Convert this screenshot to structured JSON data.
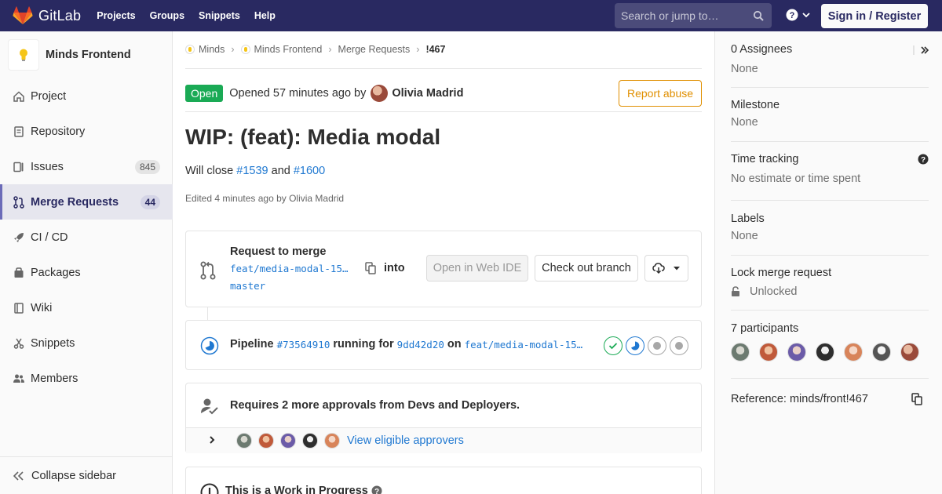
{
  "navbar": {
    "brand": "GitLab",
    "links": [
      "Projects",
      "Groups",
      "Snippets",
      "Help"
    ],
    "search_placeholder": "Search or jump to…",
    "signin": "Sign in / Register"
  },
  "sidebar": {
    "project_name": "Minds Frontend",
    "items": [
      {
        "label": "Project",
        "icon": "home-icon"
      },
      {
        "label": "Repository",
        "icon": "doc-icon"
      },
      {
        "label": "Issues",
        "icon": "issues-icon",
        "badge": "845"
      },
      {
        "label": "Merge Requests",
        "icon": "merge-request-icon",
        "badge": "44",
        "active": true
      },
      {
        "label": "CI / CD",
        "icon": "rocket-icon"
      },
      {
        "label": "Packages",
        "icon": "package-icon"
      },
      {
        "label": "Wiki",
        "icon": "book-icon"
      },
      {
        "label": "Snippets",
        "icon": "scissors-icon"
      },
      {
        "label": "Members",
        "icon": "users-icon"
      }
    ],
    "collapse": "Collapse sidebar"
  },
  "breadcrumb": {
    "items": [
      "Minds",
      "Minds Frontend",
      "Merge Requests"
    ],
    "current": "!467"
  },
  "mr": {
    "status": "Open",
    "opened_text": "Opened 57 minutes ago by",
    "author": "Olivia Madrid",
    "report": "Report abuse",
    "title": "WIP: (feat): Media modal",
    "desc_prefix": "Will close",
    "issue1": "#1539",
    "desc_and": "and",
    "issue2": "#1600",
    "edited": "Edited 4 minutes ago by Olivia Madrid"
  },
  "merge": {
    "title": "Request to merge",
    "source": "feat/media-modal-15…",
    "into": "into",
    "target": "master",
    "web_ide": "Open in Web IDE",
    "checkout": "Check out branch"
  },
  "pipeline": {
    "label": "Pipeline",
    "id": "#73564910",
    "running_for": "running for",
    "commit": "9dd42d20",
    "on": "on",
    "branch": "feat/media-modal-15…",
    "stages": [
      "passed",
      "running",
      "created",
      "created"
    ]
  },
  "approvals": {
    "text": "Requires 2 more approvals from Devs and Deployers.",
    "link": "View eligible approvers"
  },
  "wip": {
    "text": "This is a Work in Progress"
  },
  "right": {
    "assignees_label": "0 Assignees",
    "assignees_value": "None",
    "milestone_label": "Milestone",
    "milestone_value": "None",
    "time_label": "Time tracking",
    "time_value": "No estimate or time spent",
    "labels_label": "Labels",
    "labels_value": "None",
    "lock_label": "Lock merge request",
    "lock_value": "Unlocked",
    "participants_label": "7 participants",
    "reference": "Reference: minds/front!467"
  },
  "colors": {
    "navbar": "#292961",
    "open": "#1aaa55",
    "link": "#1f78d1",
    "warning": "#e08f00"
  }
}
